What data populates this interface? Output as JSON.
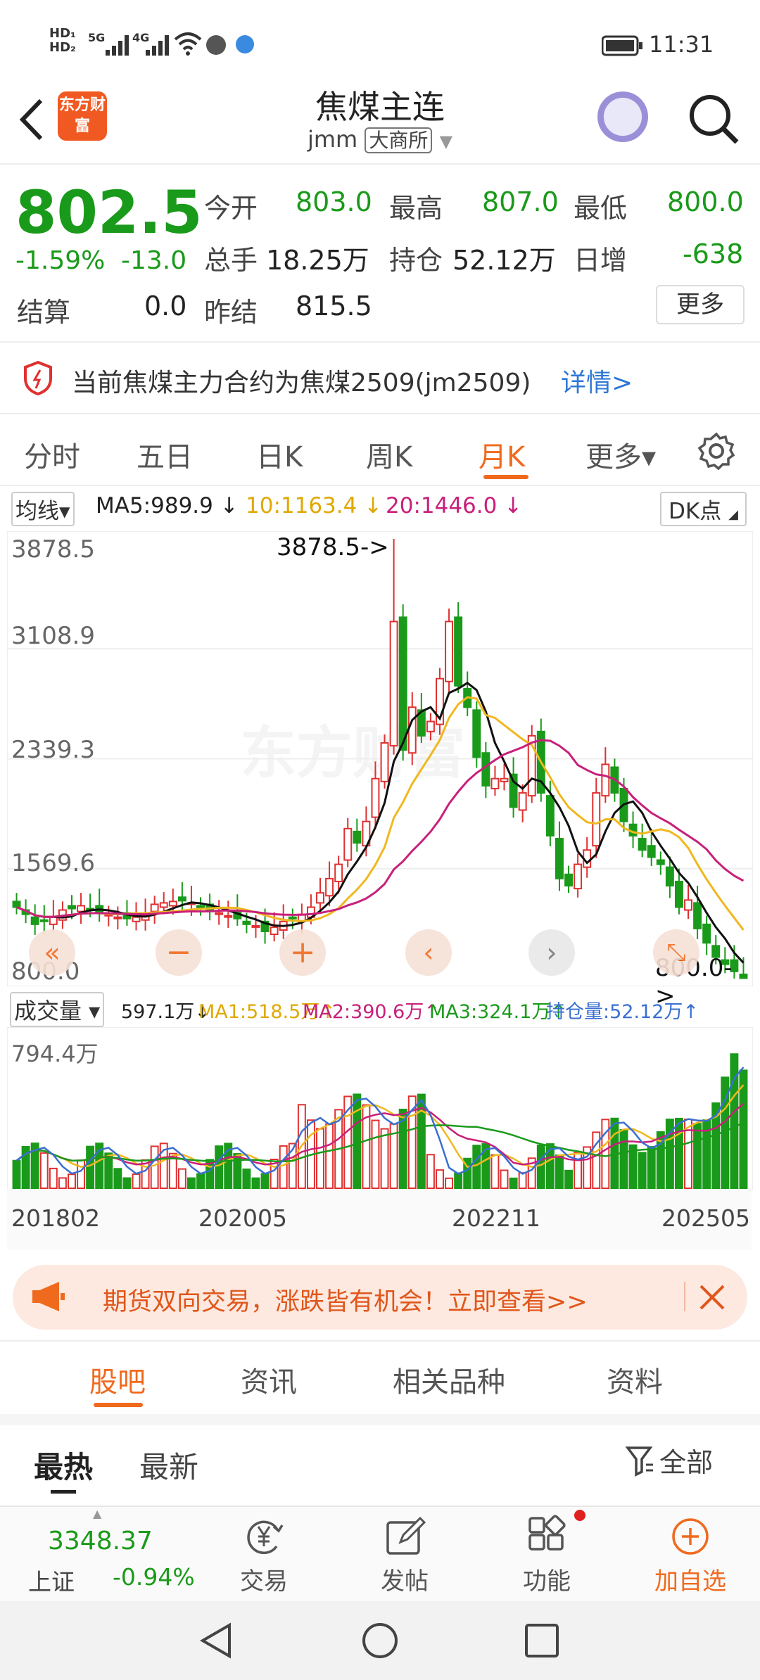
{
  "status_bar": {
    "left_signals": [
      "HD₁",
      "HD₂",
      "5G",
      "4G"
    ],
    "time": "11:31"
  },
  "header": {
    "title": "焦煤主连",
    "code": "jmm",
    "exchange": "大商所",
    "logo_text": "东方财富"
  },
  "quote": {
    "price": "802.5",
    "change_pct": "-1.59%",
    "change": "-13.0",
    "open_label": "今开",
    "open": "803.0",
    "high_label": "最高",
    "high": "807.0",
    "low_label": "最低",
    "low": "800.0",
    "volume_label": "总手",
    "volume": "18.25万",
    "oi_label": "持仓",
    "oi": "52.12万",
    "daily_inc_label": "日增",
    "daily_inc": "-638",
    "settle_label": "结算",
    "settle": "0.0",
    "prev_settle_label": "昨结",
    "prev_settle": "815.5",
    "more_label": "更多"
  },
  "notice": {
    "text": "当前焦煤主力合约为焦煤2509(jm2509)",
    "link": "详情>"
  },
  "chart_tabs": [
    "分时",
    "五日",
    "日K",
    "周K",
    "月K",
    "更多▾"
  ],
  "active_tab": "月K",
  "ma_legend": {
    "selector": "均线▾",
    "ma5": "MA5:989.9 ↓",
    "ma10": "10:1163.4 ↓",
    "ma20": "20:1446.0 ↓",
    "dk": "DK点"
  },
  "price_axis": [
    "3878.5",
    "3108.9",
    "2339.3",
    "1569.6",
    "800.0"
  ],
  "price_annotations": {
    "max": "3878.5->",
    "min": "800.0->"
  },
  "volume_legend": {
    "selector": "成交量 ▾",
    "vol": "597.1万↓",
    "ma1": "MA1:518.5万↑",
    "ma2": "MA2:390.6万↑",
    "ma3": "MA3:324.1万↑",
    "oi": "持仓量:52.12万↑"
  },
  "volume_axis_max": "794.4万",
  "date_axis": [
    "201802",
    "202005",
    "202211",
    "202505"
  ],
  "colors": {
    "up": "#e03030",
    "down": "#1a9a1a",
    "accent": "#f06a1e",
    "ma5": "#111111",
    "ma10": "#f0b820",
    "ma20": "#c8207a",
    "ma3": "#1a9a1a",
    "oi_line": "#3a6fd0"
  },
  "promo": {
    "text": "期货双向交易，涨跌皆有机会！立即查看>>"
  },
  "section_tabs": [
    "股吧",
    "资讯",
    "相关品种",
    "资料"
  ],
  "active_section": "股吧",
  "sort_tabs": [
    "最热",
    "最新"
  ],
  "filter_label": "全部",
  "bottom_nav": {
    "index_value": "3348.37",
    "index_name": "上证",
    "index_change": "-0.94%",
    "items": [
      "交易",
      "发帖",
      "功能",
      "加自选"
    ]
  },
  "chart_data": [
    {
      "type": "candlestick",
      "title": "焦煤主连 月K",
      "x_start": "201802",
      "x_end": "202505",
      "ylim": [
        800.0,
        3878.5
      ],
      "max_label": 3878.5,
      "min_label": 800.0,
      "approx_close": [
        1300,
        1250,
        1180,
        1200,
        1230,
        1280,
        1290,
        1310,
        1280,
        1260,
        1250,
        1230,
        1220,
        1230,
        1240,
        1320,
        1330,
        1340,
        1345,
        1330,
        1290,
        1270,
        1260,
        1240,
        1220,
        1180,
        1170,
        1130,
        1160,
        1200,
        1220,
        1250,
        1300,
        1400,
        1500,
        1600,
        1850,
        1750,
        1900,
        2200,
        2450,
        3300,
        2400,
        2700,
        2500,
        2600,
        2900,
        3300,
        2850,
        2700,
        2350,
        2150,
        2200,
        2200,
        2000,
        2100,
        2500,
        2100,
        1800,
        1500,
        1450,
        1600,
        1700,
        2100,
        2300,
        2100,
        1900,
        1800,
        1700,
        1650,
        1600,
        1450,
        1300,
        1350,
        1150,
        1050,
        950,
        900,
        850,
        802.5
      ],
      "ma5_last": 989.9,
      "ma10_last": 1163.4,
      "ma20_last": 1446.0
    },
    {
      "type": "bar",
      "title": "成交量",
      "ylim": [
        0,
        794.4
      ],
      "unit": "万",
      "last": 597.1,
      "ma1": 518.5,
      "ma2": 390.6,
      "ma3": 324.1,
      "open_interest": 52.12
    }
  ]
}
